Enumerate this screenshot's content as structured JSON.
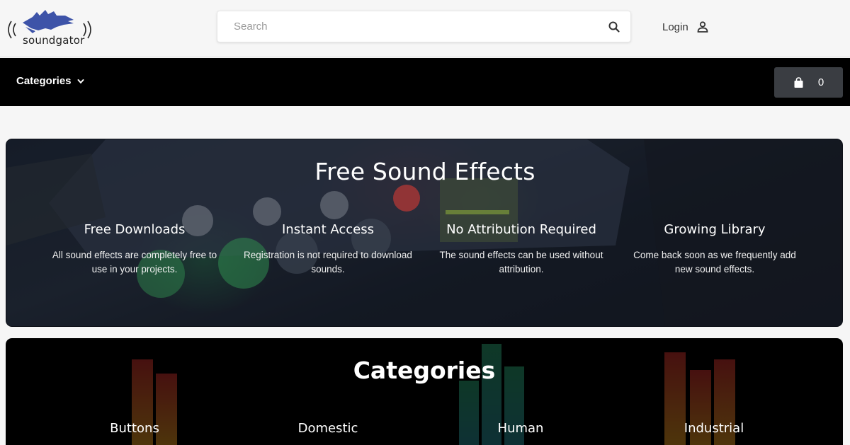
{
  "brand": {
    "name": "soundgator",
    "accent": "#3d53a8"
  },
  "search": {
    "placeholder": "Search",
    "icon": "search-icon"
  },
  "header": {
    "login_label": "Login",
    "login_icon": "user-icon"
  },
  "navbar": {
    "categories_label": "Categories",
    "cart_count": "0",
    "cart_icon": "shopping-bag-icon"
  },
  "hero": {
    "title": "Free Sound Effects",
    "features": [
      {
        "title": "Free Downloads",
        "text": "All sound effects are completely free to use in your projects."
      },
      {
        "title": "Instant Access",
        "text": "Registration is not required to download sounds."
      },
      {
        "title": "No Attribution Required",
        "text": "The sound effects can be used without attribution."
      },
      {
        "title": "Growing Library",
        "text": "Come back soon as we frequently add new sound effects."
      }
    ]
  },
  "categories": {
    "title": "Categories",
    "items": [
      "Buttons",
      "Domestic",
      "Human",
      "Industrial"
    ]
  }
}
